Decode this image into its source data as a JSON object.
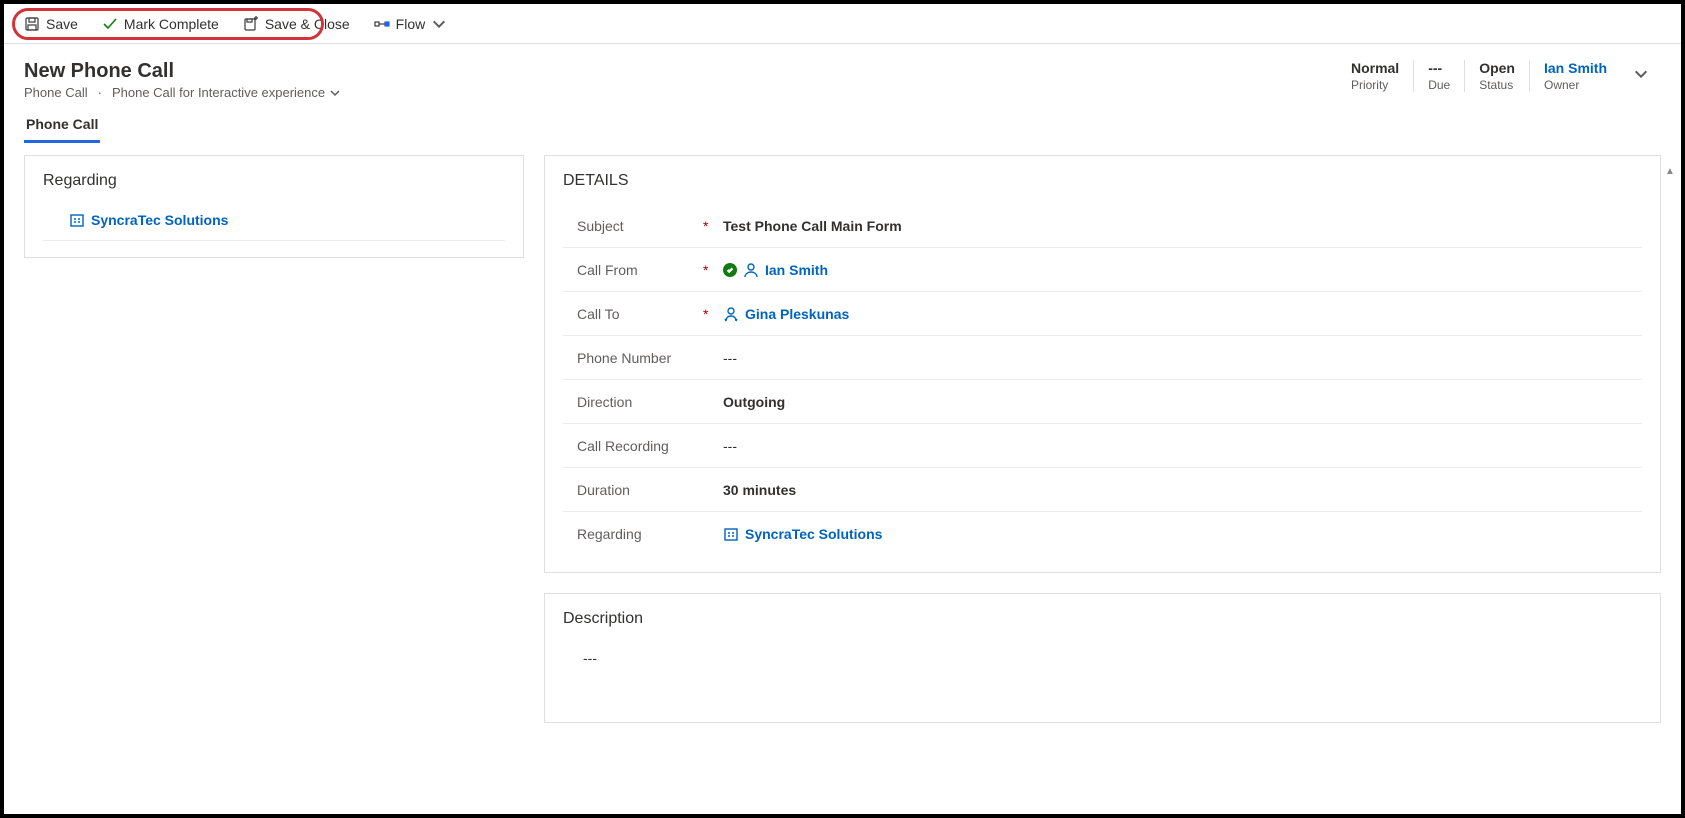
{
  "commands": {
    "save": "Save",
    "mark_complete": "Mark Complete",
    "save_close": "Save & Close",
    "flow": "Flow"
  },
  "header": {
    "title": "New Phone Call",
    "entity": "Phone Call",
    "form_name": "Phone Call for Interactive experience",
    "stats": {
      "priority": {
        "value": "Normal",
        "label": "Priority"
      },
      "due": {
        "value": "---",
        "label": "Due"
      },
      "status": {
        "value": "Open",
        "label": "Status"
      },
      "owner": {
        "value": "Ian Smith",
        "label": "Owner"
      }
    }
  },
  "tabs": {
    "phone_call": "Phone Call"
  },
  "regarding_card": {
    "title": "Regarding",
    "value": "SyncraTec Solutions"
  },
  "details_card": {
    "title": "DETAILS",
    "fields": {
      "subject": {
        "label": "Subject",
        "required": "*",
        "value": "Test Phone Call Main Form"
      },
      "call_from": {
        "label": "Call From",
        "required": "*",
        "value": "Ian Smith"
      },
      "call_to": {
        "label": "Call To",
        "required": "*",
        "value": "Gina Pleskunas"
      },
      "phone_number": {
        "label": "Phone Number",
        "required": "",
        "value": "---"
      },
      "direction": {
        "label": "Direction",
        "required": "",
        "value": "Outgoing"
      },
      "call_recording": {
        "label": "Call Recording",
        "required": "",
        "value": "---"
      },
      "duration": {
        "label": "Duration",
        "required": "",
        "value": "30 minutes"
      },
      "regarding": {
        "label": "Regarding",
        "required": "",
        "value": "SyncraTec Solutions"
      }
    }
  },
  "description_card": {
    "title": "Description",
    "value": "---"
  }
}
